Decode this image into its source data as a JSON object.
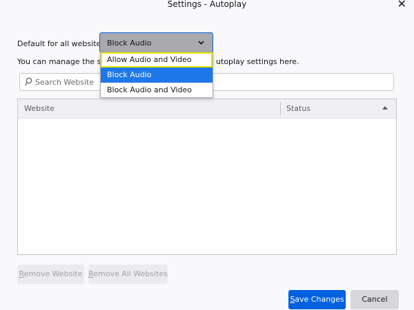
{
  "window": {
    "title": "Settings - Autoplay"
  },
  "default_setting": {
    "label": "Default for all websites:",
    "selected": "Block Audio",
    "options": [
      "Allow Audio and Video",
      "Block Audio",
      "Block Audio and Video"
    ]
  },
  "description": {
    "visible_left": "You can manage the site",
    "visible_right": "utoplay settings here."
  },
  "search": {
    "placeholder": "Search Website",
    "value": ""
  },
  "table": {
    "columns": [
      "Website",
      "Status"
    ],
    "sort_column": "Status",
    "sort_direction": "ascending",
    "rows": []
  },
  "buttons": {
    "remove_website": "Remove Website",
    "remove_all": "Remove All Websites",
    "save": "Save Changes",
    "cancel": "Cancel"
  },
  "colors": {
    "accent": "#0061e0",
    "dropdown_highlight": "#1e78ea",
    "focus_ring": "#ede500"
  }
}
